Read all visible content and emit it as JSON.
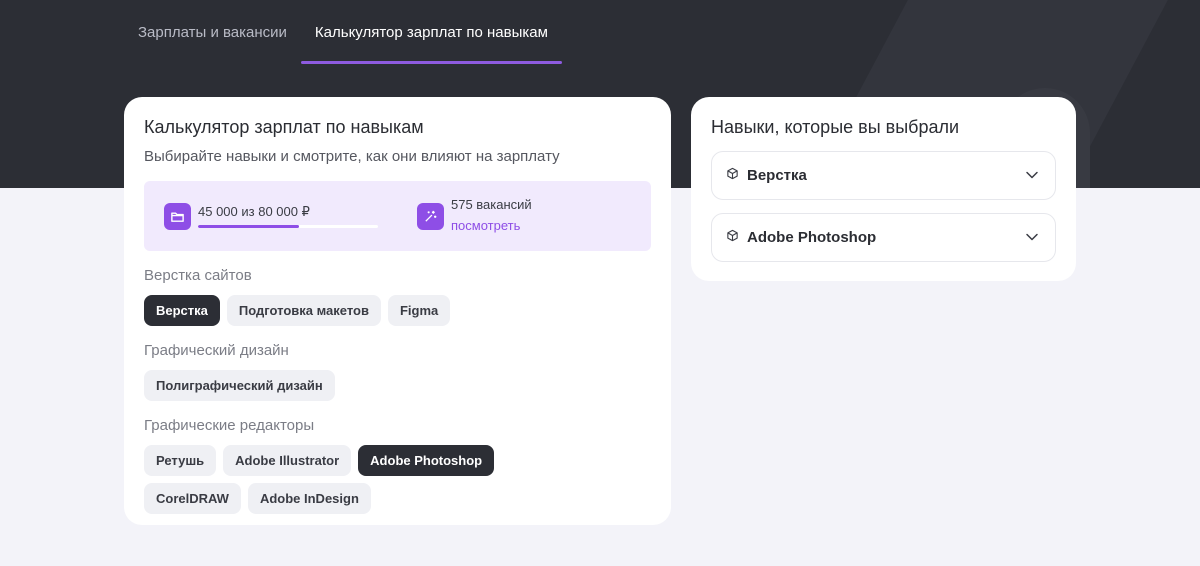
{
  "tabs": [
    {
      "label": "Зарплаты и вакансии",
      "active": false
    },
    {
      "label": "Калькулятор зарплат по навыкам",
      "active": true
    }
  ],
  "calculator": {
    "title": "Калькулятор зарплат по навыкам",
    "subtitle": "Выбирайте навыки и смотрите, как они влияют на зарплату",
    "salary_text": "45 000 из 80 000 ₽",
    "salary_progress": 0.5625,
    "vacancies_text": "575 вакансий",
    "vacancies_link": "посмотреть",
    "accent_color": "#8e4ee6",
    "groups": [
      {
        "title": "Верстка сайтов",
        "chips": [
          {
            "label": "Верстка",
            "selected": true
          },
          {
            "label": "Подготовка макетов",
            "selected": false
          },
          {
            "label": "Figma",
            "selected": false
          }
        ]
      },
      {
        "title": "Графический дизайн",
        "chips": [
          {
            "label": "Полиграфический дизайн",
            "selected": false
          }
        ]
      },
      {
        "title": "Графические редакторы",
        "chips": [
          {
            "label": "Ретушь",
            "selected": false
          },
          {
            "label": "Adobe Illustrator",
            "selected": false
          },
          {
            "label": "Adobe Photoshop",
            "selected": true
          },
          {
            "label": "CorelDRAW",
            "selected": false
          },
          {
            "label": "Adobe InDesign",
            "selected": false
          }
        ]
      }
    ]
  },
  "selected_panel": {
    "title": "Навыки, которые вы выбрали",
    "items": [
      {
        "label": "Верстка",
        "icon": "cube-icon"
      },
      {
        "label": "Adobe Photoshop",
        "icon": "cube-icon"
      }
    ]
  }
}
